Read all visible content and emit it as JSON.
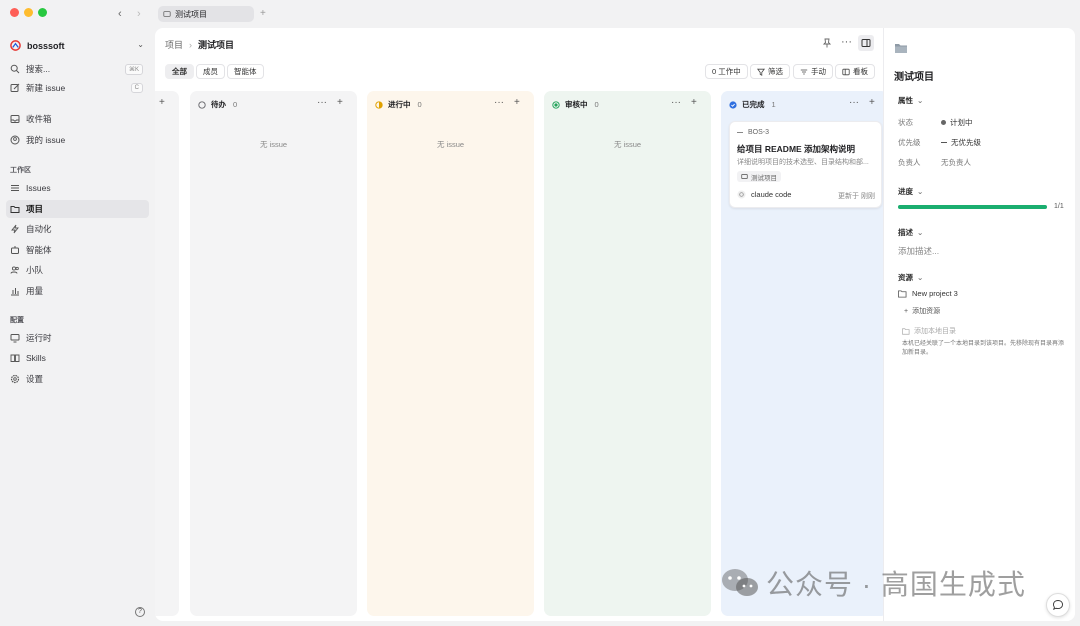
{
  "window": {
    "tab_title": "测试项目",
    "new_tab_symbol": "+"
  },
  "sidebar": {
    "workspace": "bosssoft",
    "search": {
      "label": "搜索...",
      "shortcut": "⌘K"
    },
    "new_issue": {
      "label": "新建 issue",
      "shortcut": "C"
    },
    "inbox": "收件箱",
    "my_issues": "我的 issue",
    "section_workspace": "工作区",
    "items": [
      {
        "label": "Issues",
        "icon": "list-icon"
      },
      {
        "label": "项目",
        "icon": "folder-icon",
        "active": true
      },
      {
        "label": "自动化",
        "icon": "bolt-icon"
      },
      {
        "label": "智能体",
        "icon": "robot-icon"
      },
      {
        "label": "小队",
        "icon": "team-icon"
      },
      {
        "label": "用量",
        "icon": "chart-icon"
      }
    ],
    "section_config": "配置",
    "config_items": [
      {
        "label": "运行时",
        "icon": "monitor-icon"
      },
      {
        "label": "Skills",
        "icon": "book-icon"
      },
      {
        "label": "设置",
        "icon": "gear-icon"
      }
    ]
  },
  "header": {
    "breadcrumb_parent": "项目",
    "breadcrumb_current": "测试项目"
  },
  "filters": {
    "tabs": [
      "全部",
      "成员",
      "智能体"
    ],
    "active_tab": "全部",
    "work_count": "0 工作中",
    "filter": "筛选",
    "sort": "手动",
    "view": "看板"
  },
  "board": {
    "columns": [
      {
        "name": "待办",
        "count": "0",
        "empty_text": "无 issue",
        "status_color": "#6b6b70"
      },
      {
        "name": "进行中",
        "count": "0",
        "empty_text": "无 issue",
        "status_color": "#e0a100"
      },
      {
        "name": "审核中",
        "count": "0",
        "empty_text": "无 issue",
        "status_color": "#22a35a"
      },
      {
        "name": "已完成",
        "count": "1",
        "status_color": "#2f6fe0"
      }
    ],
    "card": {
      "id": "BOS-3",
      "title": "给项目 README 添加架构说明",
      "desc": "详细说明项目的技术选型、目录结构和部...",
      "project": "测试项目",
      "assignee": "claude code",
      "updated": "更新于 刚刚"
    }
  },
  "panel": {
    "title": "测试项目",
    "props_label": "属性",
    "status_key": "状态",
    "status_val": "计划中",
    "priority_key": "优先级",
    "priority_val": "无优先级",
    "owner_key": "负责人",
    "owner_val": "无负责人",
    "progress_label": "进度",
    "progress_value": 1.0,
    "progress_text": "1/1",
    "desc_label": "描述",
    "desc_placeholder": "添加描述...",
    "resources_label": "资源",
    "resource_item": "New project 3",
    "add_resource": "添加资源",
    "add_local_dir": "添加本地目录",
    "local_hint": "本机已经关联了一个本地目录到该项目。先移除现有目录再添加新目录。"
  },
  "watermark": "公众号 · 高国生成式",
  "colors": {
    "accent_green": "#1aae6f",
    "todo_bg": "#f4f4f5",
    "progress_bg": "#fdf6ec",
    "review_bg": "#eef5f0",
    "done_bg": "#eaf1fb"
  }
}
